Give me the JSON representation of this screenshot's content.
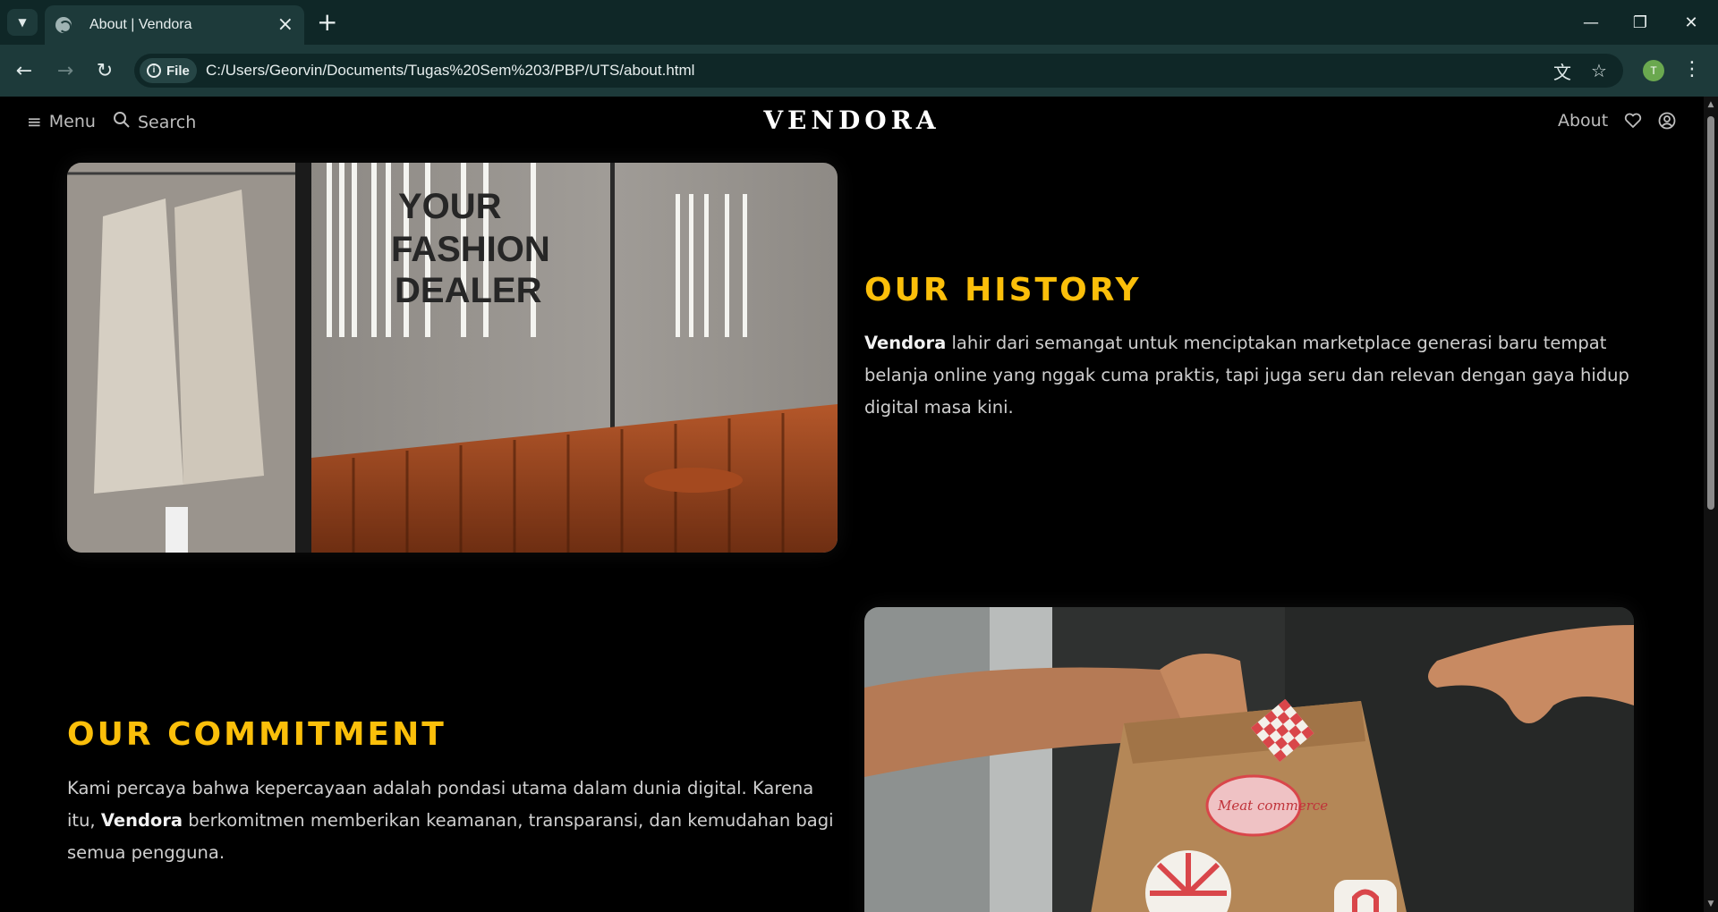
{
  "browser": {
    "tab_title": "About | Vendora",
    "new_tab_icon": "plus-icon",
    "url_scheme_label": "File",
    "url": "C:/Users/Georvin/Documents/Tugas%20Sem%203/PBP/UTS/about.html",
    "profile_initial": "T"
  },
  "site": {
    "brand": "VENDORA",
    "menu_label": "Menu",
    "search_label": "Search",
    "about_label": "About"
  },
  "history": {
    "title": "OUR HISTORY",
    "brand_strong": "Vendora",
    "text": " lahir dari semangat untuk menciptakan marketplace generasi baru tempat belanja online yang nggak cuma praktis, tapi juga seru dan relevan dengan gaya hidup digital masa kini.",
    "image_sign": [
      "YOUR",
      "FASHION",
      "DEALER"
    ]
  },
  "commitment": {
    "title": "OUR COMMITMENT",
    "text_before": "Kami percaya bahwa kepercayaan adalah pondasi utama dalam dunia digital. Karena itu, ",
    "brand_strong": "Vendora",
    "text_after": " berkomitmen memberikan keamanan, transparansi, dan kemudahan bagi semua pengguna.",
    "bag_sticker": "Meat commerce"
  },
  "colors": {
    "accent": "#fbbf0a",
    "background": "#000000",
    "chrome_dark": "#0f2727",
    "chrome_toolbar": "#1d3a3a"
  }
}
